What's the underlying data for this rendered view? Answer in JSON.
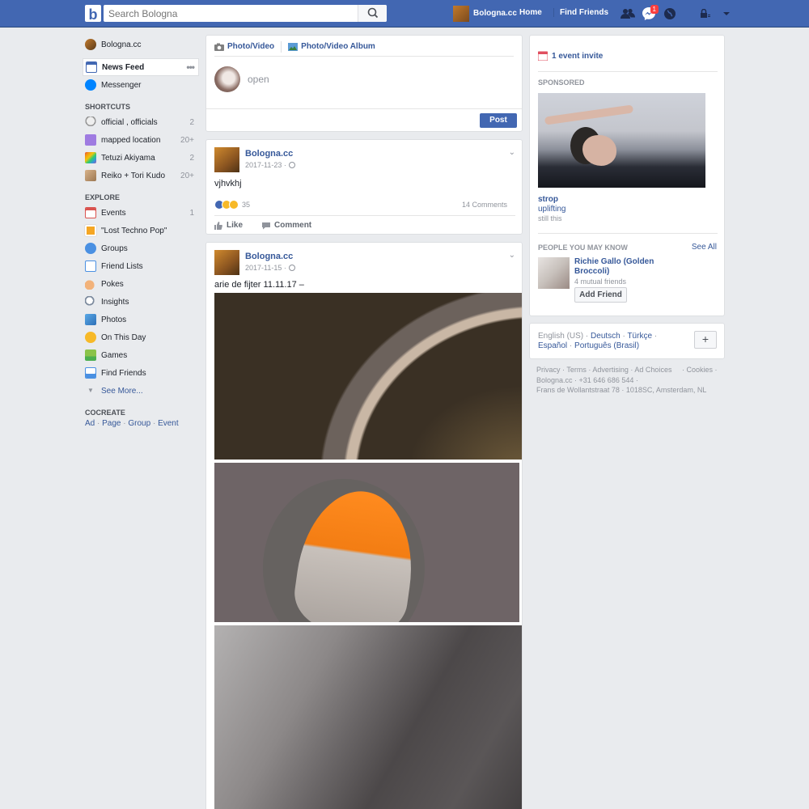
{
  "header": {
    "logo": "b",
    "search_placeholder": "Search Bologna",
    "profile_name": "Bologna.cc",
    "home": "Home",
    "find_friends": "Find Friends",
    "messages_badge": "1"
  },
  "sidebar": {
    "profile": "Bologna.cc",
    "news_feed": "News Feed",
    "messenger": "Messenger",
    "shortcuts_heading": "Shortcuts",
    "shortcuts": [
      {
        "label": "official , officials",
        "count": "2",
        "icon": "skull-icon"
      },
      {
        "label": "mapped location",
        "count": "20+",
        "icon": "music-note-icon"
      },
      {
        "label": "Tetuzi Akiyama",
        "count": "2",
        "icon": "rainbow-icon"
      },
      {
        "label": "Reiko + Tori Kudo",
        "count": "20+",
        "icon": "group-avatar-icon"
      }
    ],
    "explore_heading": "Explore",
    "explore": [
      {
        "label": "Events",
        "count": "1",
        "icon": "calendar-icon"
      },
      {
        "label": "\"Lost Techno Pop\"",
        "count": "",
        "icon": "page-icon"
      },
      {
        "label": "Groups",
        "count": "",
        "icon": "groups-icon"
      },
      {
        "label": "Friend Lists",
        "count": "",
        "icon": "friend-list-icon"
      },
      {
        "label": "Pokes",
        "count": "",
        "icon": "poke-hand-icon"
      },
      {
        "label": "Insights",
        "count": "",
        "icon": "insights-icon"
      },
      {
        "label": "Photos",
        "count": "",
        "icon": "photos-icon"
      },
      {
        "label": "On This Day",
        "count": "",
        "icon": "on-this-day-icon"
      },
      {
        "label": "Games",
        "count": "",
        "icon": "games-icon"
      },
      {
        "label": "Find Friends",
        "count": "",
        "icon": "find-friends-icon"
      }
    ],
    "see_more": "See More...",
    "cocreate_heading": "Cocreate",
    "cocreate": [
      "Ad",
      "Page",
      "Group",
      "Event"
    ]
  },
  "composer": {
    "tab_photo_video": "Photo/Video",
    "tab_album": "Photo/Video Album",
    "placeholder": "open",
    "post_button": "Post"
  },
  "posts": [
    {
      "author": "Bologna.cc",
      "date": "2017-11-23",
      "text": "vjhvkhj",
      "reaction_count": "35",
      "comments": "14 Comments",
      "like": "Like",
      "comment": "Comment"
    },
    {
      "author": "Bologna.cc",
      "date": "2017-11-15",
      "text": "arie de fijter 11.11.17 –"
    }
  ],
  "right": {
    "event_invite": "1 event invite",
    "sponsored": "Sponsored",
    "ad_title": "strop",
    "ad_subtitle": "uplifting",
    "ad_desc": "still this",
    "pymk_heading": "People You May Know",
    "see_all": "See All",
    "pymk_name": "Richie Gallo (Golden Broccoli)",
    "pymk_mutual": "4 mutual friends",
    "add_friend": "Add Friend",
    "languages": [
      "English (US)",
      "Deutsch",
      "Türkçe",
      "Español",
      "Português (Brasil)"
    ],
    "plus": "+"
  },
  "footer": {
    "links": [
      "Privacy",
      "Terms",
      "Advertising",
      "Ad Choices",
      "Cookies"
    ],
    "line2": "Bologna.cc · +31 646 686 544 ·",
    "line3": "Frans de Wollantstraat 78 · 1018SC, Amsterdam, NL"
  },
  "colors": {
    "brand": "#4267b2",
    "link": "#365899",
    "background": "#e9ebee",
    "badge": "#fa3e3e"
  }
}
